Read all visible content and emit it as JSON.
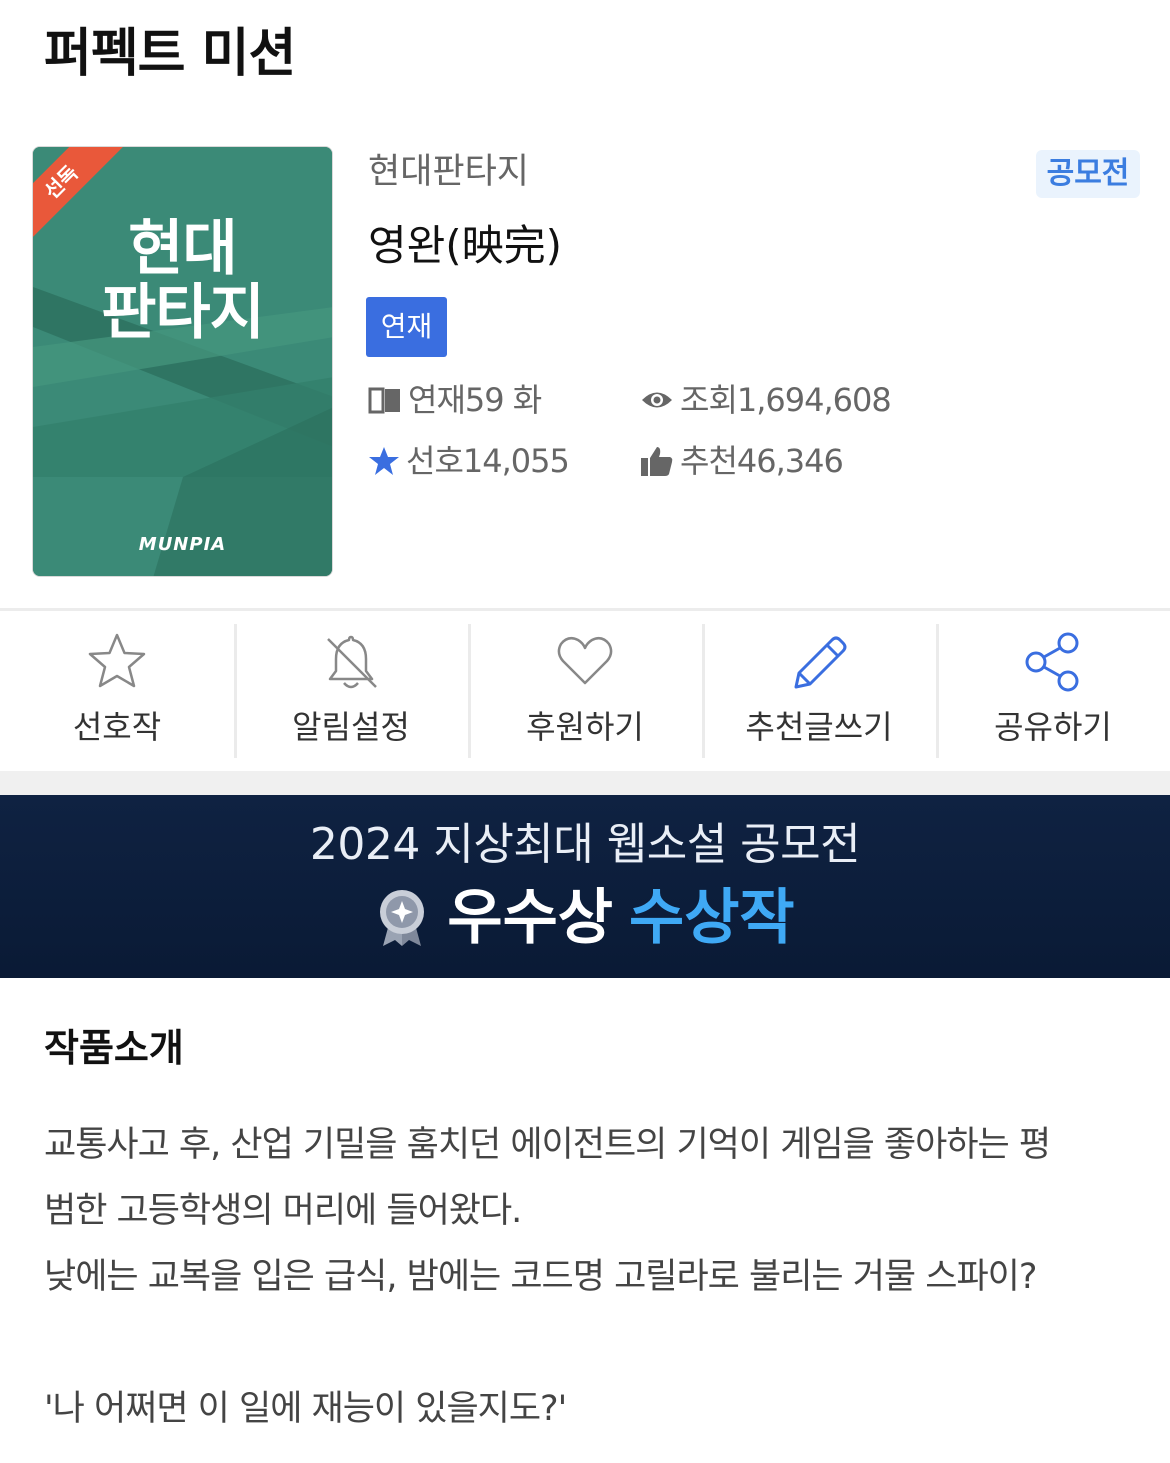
{
  "header": {
    "title": "퍼펙트 미션"
  },
  "cover": {
    "badge": "선독",
    "title_line1": "현대",
    "title_line2": "판타지",
    "brand": "MUNPIA"
  },
  "novel": {
    "genre": "현대판타지",
    "contest_badge": "공모전",
    "title": "영완(映完)",
    "status": "연재",
    "stats": {
      "episodes": "연재59 화",
      "views": "조회1,694,608",
      "favorites": "선호14,055",
      "recommends": "추천46,346"
    }
  },
  "actions": [
    {
      "label": "선호작",
      "icon": "star-outline-icon"
    },
    {
      "label": "알림설정",
      "icon": "bell-off-icon"
    },
    {
      "label": "후원하기",
      "icon": "heart-outline-icon"
    },
    {
      "label": "추천글쓰기",
      "icon": "pencil-icon"
    },
    {
      "label": "공유하기",
      "icon": "share-icon"
    }
  ],
  "banner": {
    "line1": "2024 지상최대 웹소설 공모전",
    "award": "우수상",
    "winner": "수상작"
  },
  "intro": {
    "heading": "작품소개",
    "lines": [
      "교통사고 후, 산업 기밀을 훔치던 에이전트의 기억이 게임을 좋아하는 평",
      "범한 고등학생의 머리에 들어왔다.",
      "낮에는 교복을 입은 급식, 밤에는 코드명 고릴라로 불리는 거물 스파이?",
      "",
      "'나 어쩌면 이 일에 재능이 있을지도?'"
    ]
  },
  "colors": {
    "cover_green": "#3b8a77",
    "badge_orange": "#e9583a",
    "status_blue": "#3a6ee0",
    "contest_blue": "#3b7de0",
    "banner_navy": "#0f2242",
    "banner_accent": "#3fa9f5"
  }
}
